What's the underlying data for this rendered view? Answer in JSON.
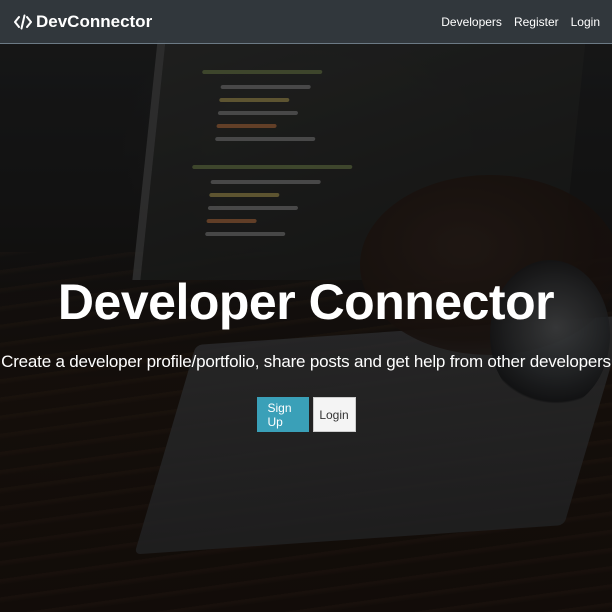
{
  "navbar": {
    "brand_icon": "code-icon",
    "brand_text": "DevConnector",
    "links": [
      {
        "label": "Developers"
      },
      {
        "label": "Register"
      },
      {
        "label": "Login"
      }
    ]
  },
  "landing": {
    "title": "Developer Connector",
    "subtitle": "Create a developer profile/portfolio, share posts and get help from other developers",
    "signup_label": "Sign Up",
    "login_label": "Login"
  },
  "colors": {
    "navbar_bg": "#343a40",
    "primary": "#3aa0b8",
    "light": "#f4f4f4",
    "text": "#ffffff"
  }
}
